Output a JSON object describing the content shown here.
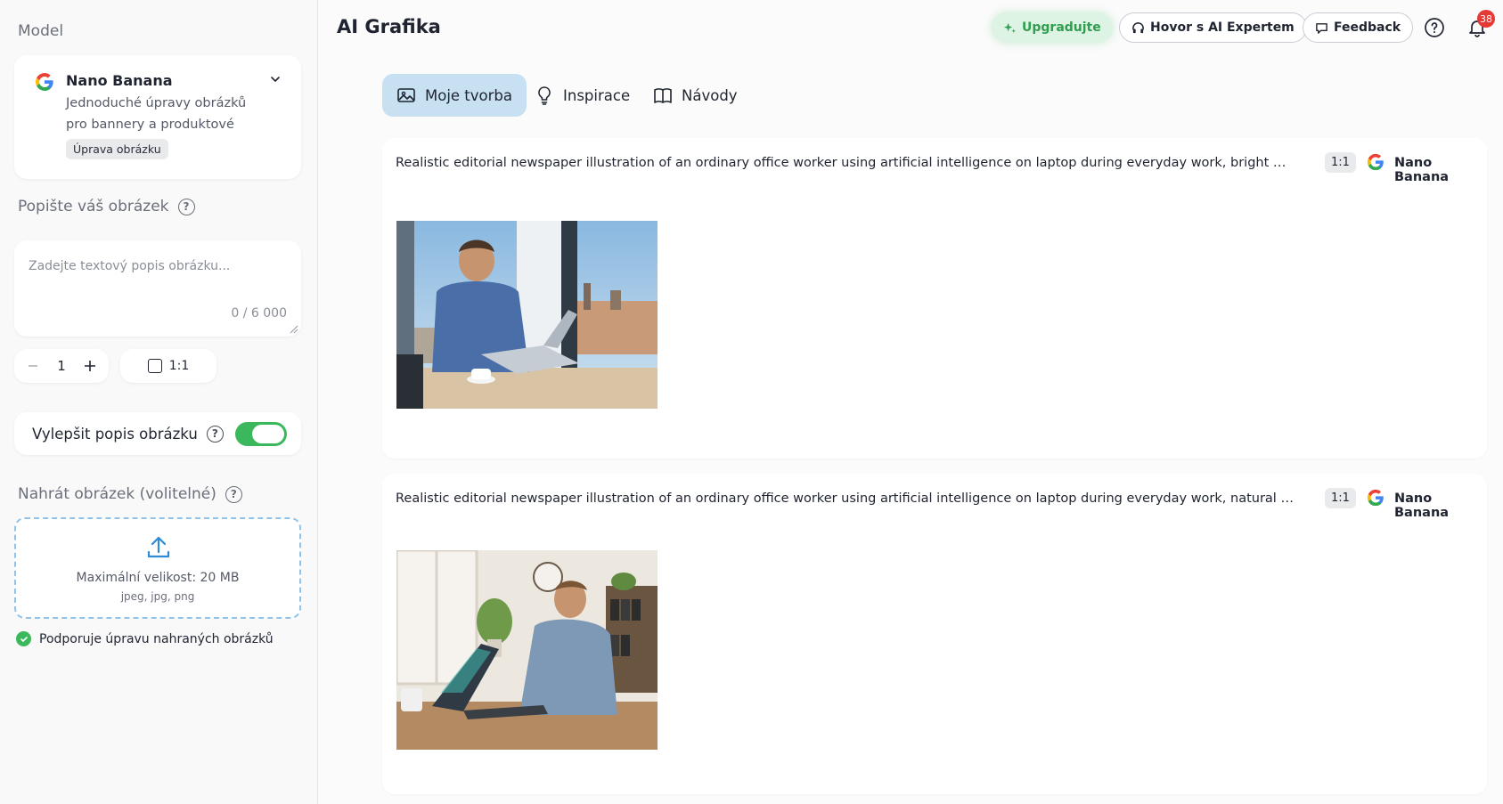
{
  "sidebar": {
    "model_label": "Model",
    "model": {
      "name": "Nano Banana",
      "description": "Jednoduché úpravy obrázků pro bannery a produktové scény.",
      "badge": "Úprava obrázku",
      "icon": "google-icon"
    },
    "describe_label": "Popište váš obrázek",
    "description_input": {
      "value": "",
      "placeholder": "Zadejte textový popis obrázku..."
    },
    "char_count": "0 / 6 000",
    "quantity": "1",
    "aspect_ratio": "1:1",
    "enhance": {
      "label": "Vylepšit popis obrázku",
      "enabled": true
    },
    "upload": {
      "label": "Nahrát obrázek (volitelné)",
      "max_size": "Maximální velikost: 20 MB",
      "formats": "jpeg, jpg, png"
    },
    "support_note": "Podporuje úpravu nahraných obrázků"
  },
  "header": {
    "title": "AI Grafika",
    "upgrade_label": "Upgradujte",
    "expert_label": "Hovor s AI Expertem",
    "feedback_label": "Feedback",
    "notification_count": "38"
  },
  "tabs": [
    {
      "label": "Moje tvorba",
      "icon": "image-icon",
      "active": true
    },
    {
      "label": "Inspirace",
      "icon": "lightbulb-icon",
      "active": false
    },
    {
      "label": "Návody",
      "icon": "book-icon",
      "active": false
    }
  ],
  "results": [
    {
      "prompt": "Realistic editorial newspaper illustration of an ordinary office worker using artificial intelligence on laptop during everyday work, bright modern Czech office with Prague view",
      "ratio": "1:1",
      "model": "Nano Banana"
    },
    {
      "prompt": "Realistic editorial newspaper illustration of an ordinary office worker using artificial intelligence on laptop during everyday work, natural Czech/European office environment",
      "ratio": "1:1",
      "model": "Nano Banana"
    }
  ],
  "colors": {
    "accent_green": "#3cb85c",
    "active_tab": "#c7e1f3",
    "badge_red": "#e53935",
    "upload_border": "#8fc3ea"
  }
}
